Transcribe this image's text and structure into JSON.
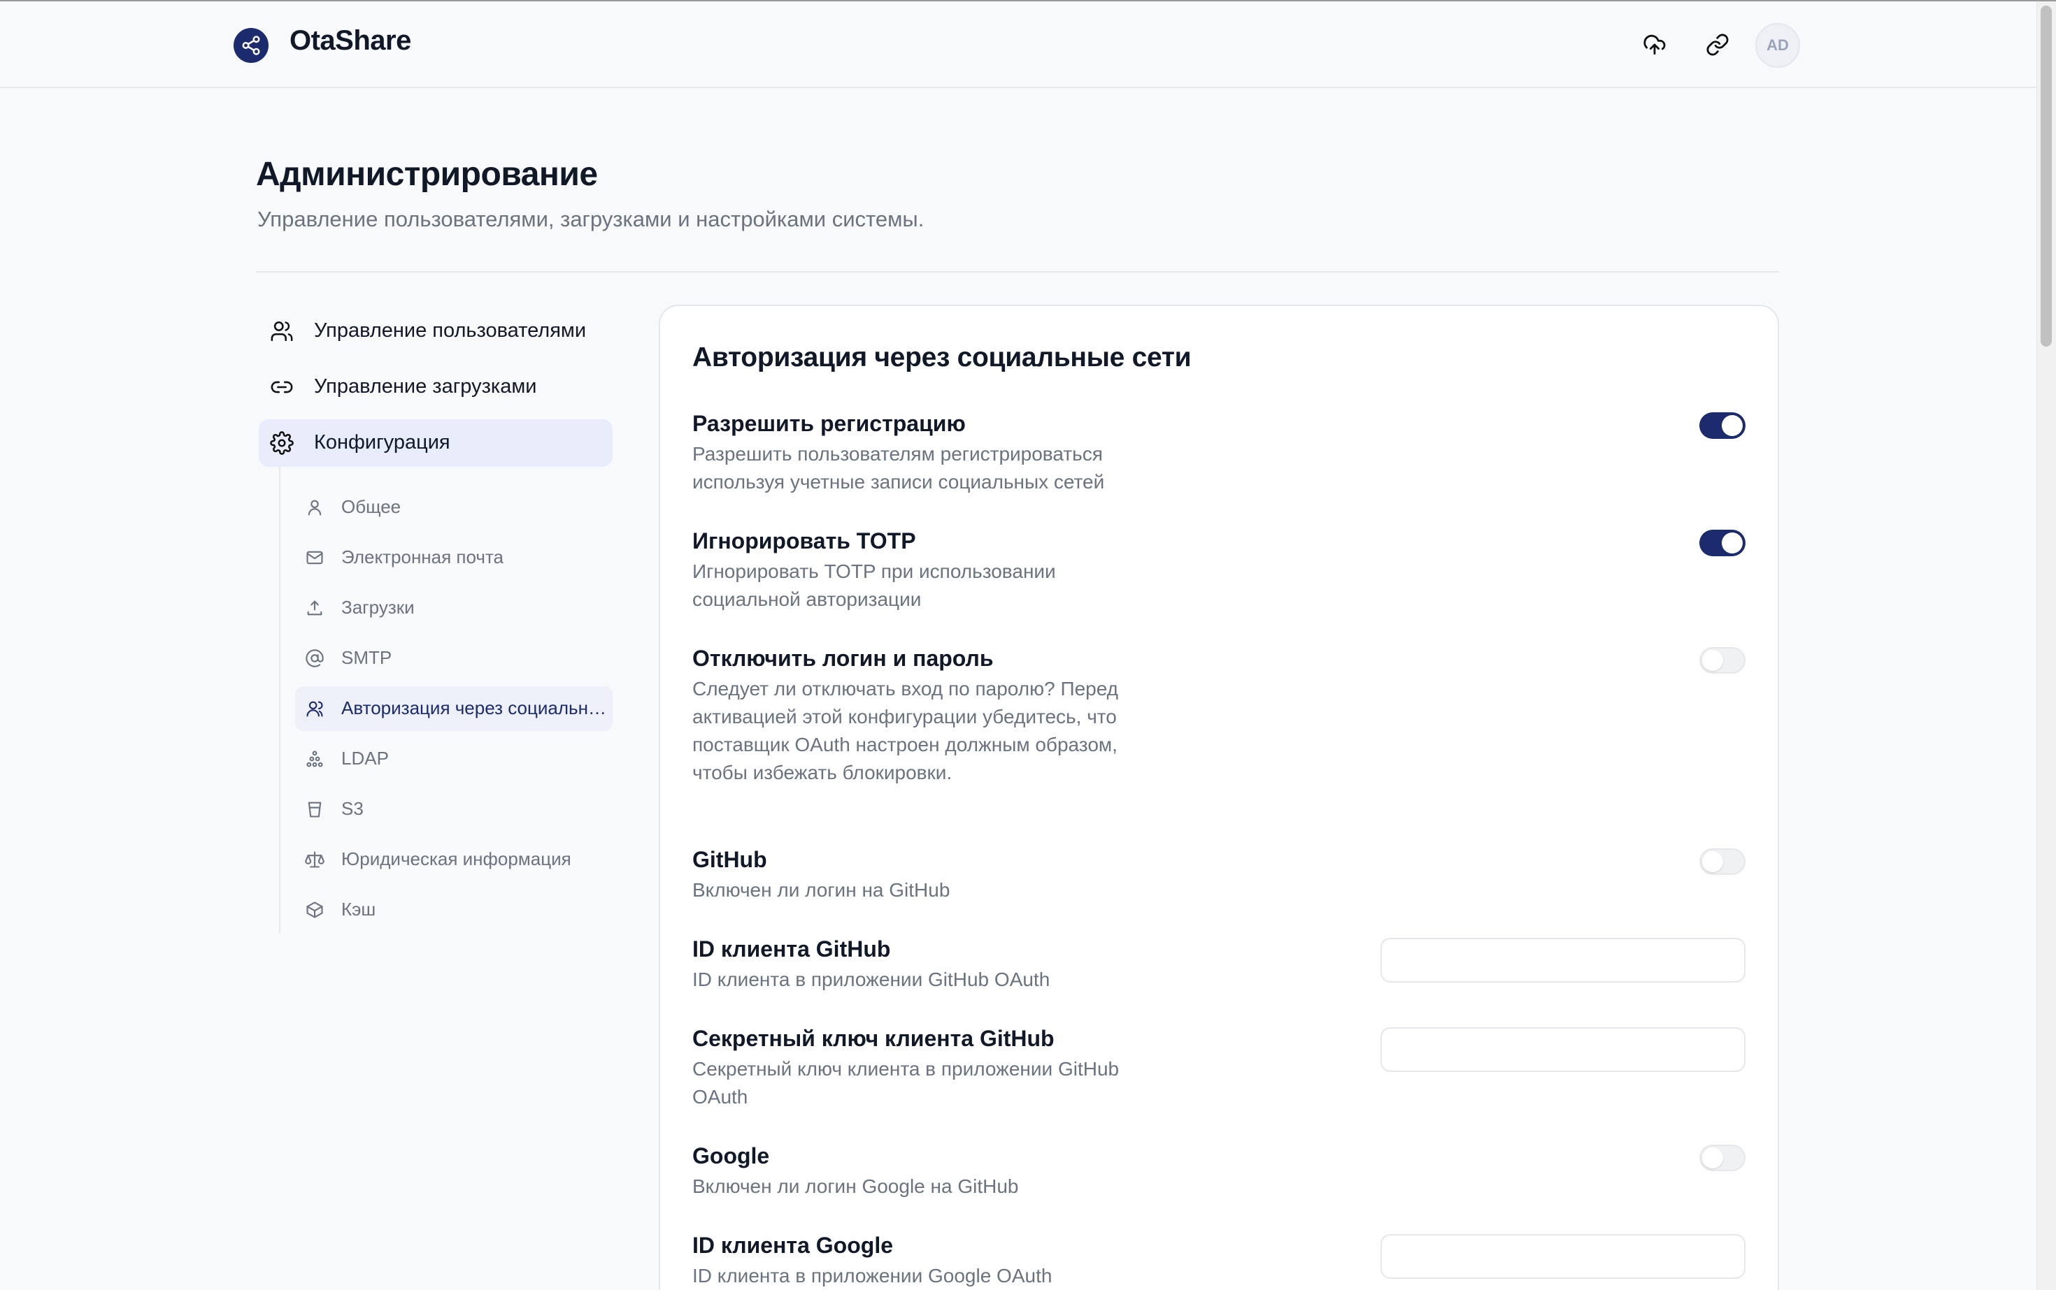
{
  "app": {
    "name": "OtaShare"
  },
  "header": {
    "avatar_initials": "AD"
  },
  "page": {
    "title": "Администрирование",
    "subtitle": "Управление пользователями, загрузками и настройками системы."
  },
  "nav": {
    "items": [
      {
        "label": "Управление пользователями",
        "icon": "users-icon"
      },
      {
        "label": "Управление загрузками",
        "icon": "link-icon"
      },
      {
        "label": "Конфигурация",
        "icon": "gear-icon"
      }
    ],
    "sub_items": [
      {
        "label": "Общее",
        "icon": "user-icon"
      },
      {
        "label": "Электронная почта",
        "icon": "mail-icon"
      },
      {
        "label": "Загрузки",
        "icon": "upload-icon"
      },
      {
        "label": "SMTP",
        "icon": "at-icon"
      },
      {
        "label": "Авторизация через социальные сети",
        "icon": "users-icon"
      },
      {
        "label": "LDAP",
        "icon": "network-icon"
      },
      {
        "label": "S3",
        "icon": "bucket-icon"
      },
      {
        "label": "Юридическая информация",
        "icon": "scale-icon"
      },
      {
        "label": "Кэш",
        "icon": "box-icon"
      }
    ]
  },
  "card": {
    "title": "Авторизация через социальные сети",
    "settings": [
      {
        "title": "Разрешить регистрацию",
        "desc": "Разрешить пользователям регистрироваться используя учетные записи социальных сетей",
        "enabled": true
      },
      {
        "title": "Игнорировать TOTP",
        "desc": "Игнорировать TOTP при использовании социальной авторизации",
        "enabled": true
      },
      {
        "title": "Отключить логин и пароль",
        "desc": "Следует ли отключать вход по паролю? Перед активацией этой конфигурации убедитесь, что поставщик OAuth настроен должным образом, чтобы избежать блокировки.",
        "enabled": false
      },
      {
        "title": "GitHub",
        "desc": "Включен ли логин на GitHub",
        "enabled": false
      },
      {
        "title": "ID клиента GitHub",
        "desc": "ID клиента в приложении GitHub OAuth",
        "value": ""
      },
      {
        "title": "Секретный ключ клиента GitHub",
        "desc": "Секретный ключ клиента в приложении GitHub OAuth",
        "value": ""
      },
      {
        "title": "Google",
        "desc": "Включен ли логин Google на GitHub",
        "enabled": false
      },
      {
        "title": "ID клиента Google",
        "desc": "ID клиента в приложении Google OAuth",
        "value": ""
      }
    ]
  },
  "colors": {
    "accent": "#1c2b6e",
    "active_nav_bg": "#e9edfb",
    "muted_text": "#6b7280"
  }
}
